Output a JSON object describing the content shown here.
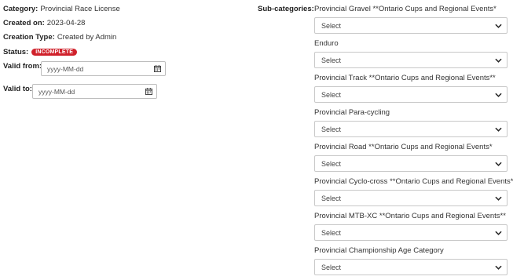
{
  "info": {
    "category_label": "Category:",
    "category_value": "Provincial Race License",
    "created_on_label": "Created on:",
    "created_on_value": "2023-04-28",
    "creation_type_label": "Creation Type:",
    "creation_type_value": "Created by Admin",
    "status_label": "Status:",
    "status_value": "INCOMPLETE",
    "status_color": "#d0212b"
  },
  "dates": {
    "valid_from_label": "Valid from:",
    "valid_from_placeholder": "yyyy-MM-dd",
    "valid_to_label": "Valid to:",
    "valid_to_placeholder": "yyyy-MM-dd",
    "calendar_icon": "calendar-icon"
  },
  "subcategories": {
    "label": "Sub-categories:",
    "select_placeholder": "Select",
    "groups": [
      {
        "label": "Provincial Gravel **Ontario Cups and Regional Events*"
      },
      {
        "label": "Enduro"
      },
      {
        "label": "Provincial Track **Ontario Cups and Regional Events**"
      },
      {
        "label": "Provincial Para-cycling"
      },
      {
        "label": "Provincial Road **Ontario Cups and Regional Events*"
      },
      {
        "label": "Provincial Cyclo-cross **Ontario Cups and Regional Events**"
      },
      {
        "label": "Provincial MTB-XC **Ontario Cups and Regional Events**"
      },
      {
        "label": "Provincial Championship Age Category"
      }
    ]
  }
}
